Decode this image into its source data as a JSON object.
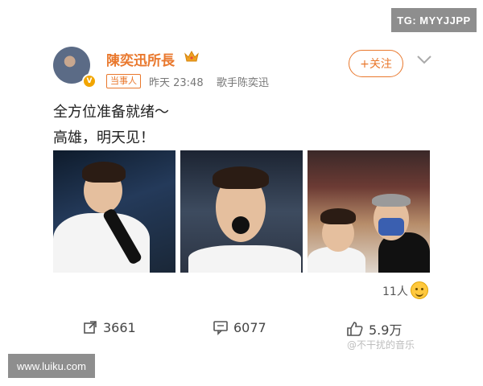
{
  "watermarks": {
    "top_right": "TG: MYYJJPP",
    "bottom_left": "www.luiku.com",
    "bottom_right": "@不干扰的音乐"
  },
  "post": {
    "username": "陳奕迅所長",
    "badge": "当事人",
    "time": "昨天 23:48",
    "source": "歌手陈奕迅",
    "follow_label": "+关注",
    "text_line1": "全方位准备就绪～",
    "text_line2": "高雄，明天见！",
    "reactions_count": "11人",
    "reposts": "3661",
    "comments": "6077",
    "likes": "5.9万"
  },
  "icons": [
    "crown-icon",
    "chevron-down-icon",
    "repost-icon",
    "comment-icon",
    "like-icon",
    "smile-emoji-icon"
  ]
}
